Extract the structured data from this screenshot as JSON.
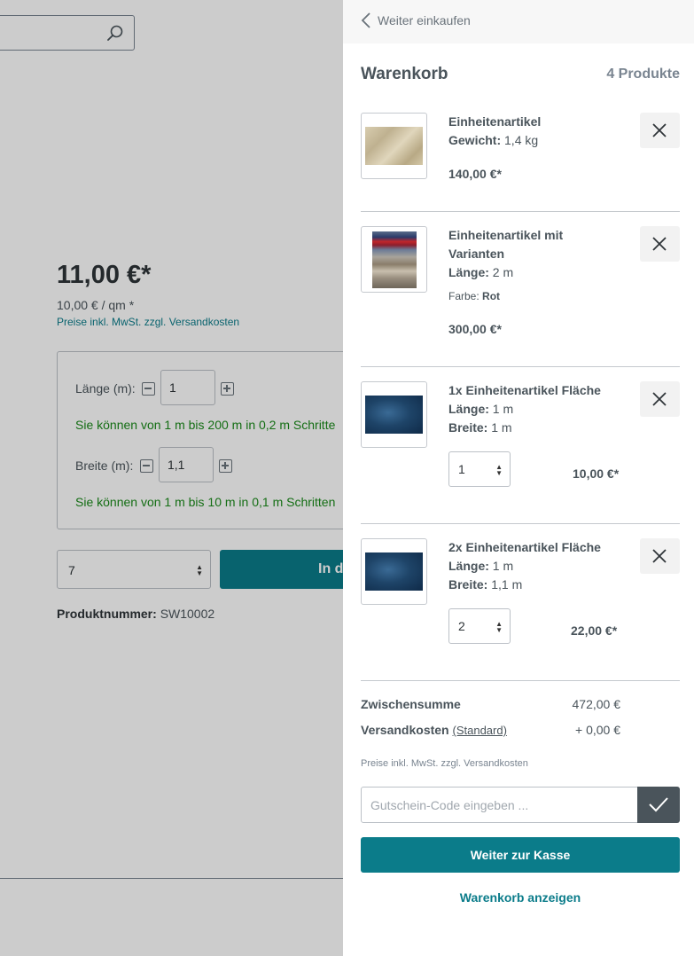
{
  "background": {
    "search": {
      "placeholder": ""
    },
    "price": "11,00 €*",
    "unit_price": "10,00 € / qm *",
    "tax_note": "Preise inkl. MwSt. zzgl. Versandkosten",
    "config": {
      "length_label": "Länge (m):",
      "length_value": "1",
      "length_hint": "Sie können von 1 m bis 200 m in 0,2 m Schritte",
      "width_label": "Breite (m):",
      "width_value": "1,1",
      "width_hint": "Sie können von 1 m bis 10 m in 0,1 m Schritten"
    },
    "quantity_value": "7",
    "buy_label": "In d",
    "product_number_label": "Produktnummer:",
    "product_number_value": "SW10002"
  },
  "cart": {
    "continue_label": "Weiter einkaufen",
    "title": "Warenkorb",
    "count": "4 Produkte",
    "items": [
      {
        "name": "Einheitenartikel",
        "attrs": [
          {
            "key": "Gewicht:",
            "value": "1,4 kg"
          }
        ],
        "price": "140,00 €*"
      },
      {
        "name": "Einheitenartikel mit Varianten",
        "attrs": [
          {
            "key": "Länge:",
            "value": "2 m"
          }
        ],
        "option_label": "Farbe:",
        "option_value": "Rot",
        "price": "300,00 €*"
      },
      {
        "name": "1x Einheitenartikel Fläche",
        "attrs": [
          {
            "key": "Länge:",
            "value": "1 m"
          },
          {
            "key": "Breite:",
            "value": "1 m"
          }
        ],
        "quantity": "1",
        "price": "10,00 €*"
      },
      {
        "name": "2x Einheitenartikel Fläche",
        "attrs": [
          {
            "key": "Länge:",
            "value": "1 m"
          },
          {
            "key": "Breite:",
            "value": "1,1 m"
          }
        ],
        "quantity": "2",
        "price": "22,00 €*"
      }
    ],
    "subtotal_label": "Zwischensumme",
    "subtotal_value": "472,00 €",
    "shipping_label": "Versandkosten",
    "shipping_method": "(Standard)",
    "shipping_value": "+ 0,00 €",
    "tax_note": "Preise inkl. MwSt. zzgl. Versandkosten",
    "voucher_placeholder": "Gutschein-Code eingeben ...",
    "checkout_label": "Weiter zur Kasse",
    "show_cart_label": "Warenkorb anzeigen"
  },
  "colors": {
    "accent": "#0b7c8a",
    "hint_green": "#1a8a1a",
    "text": "#4a545b"
  }
}
